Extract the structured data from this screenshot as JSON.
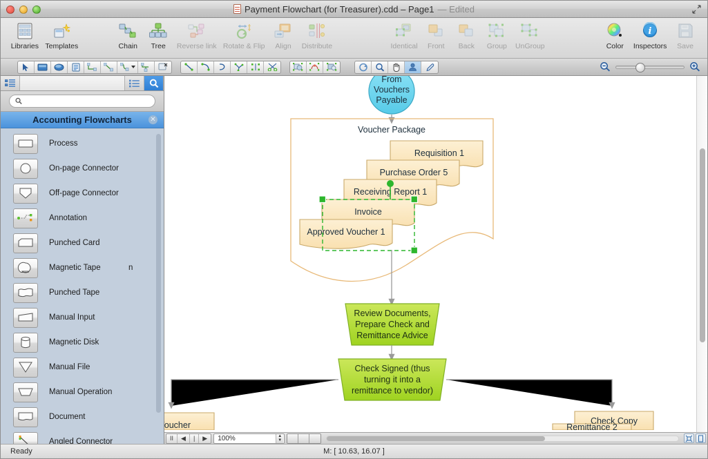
{
  "window": {
    "title": "Payment Flowchart (for Treasurer).cdd – Page1",
    "title_state": "— Edited",
    "doc_icon": "document-icon",
    "buttons": {
      "close": "close-window",
      "minimize": "minimize-window",
      "zoom": "zoom-window"
    },
    "fullscreen_icon": "fullscreen-icon"
  },
  "toolbar_main": {
    "items": [
      {
        "label": "Libraries",
        "icon": "libraries-icon",
        "enabled": true
      },
      {
        "label": "Templates",
        "icon": "templates-icon",
        "enabled": true
      },
      {
        "label": "Chain",
        "icon": "chain-icon",
        "enabled": true
      },
      {
        "label": "Tree",
        "icon": "tree-icon",
        "enabled": true
      },
      {
        "label": "Reverse link",
        "icon": "reverse-link-icon",
        "enabled": false
      },
      {
        "label": "Rotate & Flip",
        "icon": "rotate-flip-icon",
        "enabled": false
      },
      {
        "label": "Align",
        "icon": "align-icon",
        "enabled": false
      },
      {
        "label": "Distribute",
        "icon": "distribute-icon",
        "enabled": false
      },
      {
        "label": "Identical",
        "icon": "identical-icon",
        "enabled": false
      },
      {
        "label": "Front",
        "icon": "bring-front-icon",
        "enabled": false
      },
      {
        "label": "Back",
        "icon": "send-back-icon",
        "enabled": false
      },
      {
        "label": "Group",
        "icon": "group-icon",
        "enabled": false
      },
      {
        "label": "UnGroup",
        "icon": "ungroup-icon",
        "enabled": false
      },
      {
        "label": "Color",
        "icon": "color-wheel-icon",
        "enabled": true
      },
      {
        "label": "Inspectors",
        "icon": "inspectors-icon",
        "enabled": true
      },
      {
        "label": "Save",
        "icon": "save-floppy-icon",
        "enabled": false
      }
    ]
  },
  "toolbar_tools": {
    "group1": [
      "pointer-icon",
      "rectangle-icon",
      "ellipse-icon",
      "text-icon",
      "smart-connector-icon",
      "direct-connector-icon",
      "curved-connector-icon",
      "tree-connector-icon",
      "delete-connector-icon"
    ],
    "group2": [
      "line-icon",
      "arc-icon",
      "bezier-icon",
      "polyline-icon",
      "mirror-icon",
      "scissors-icon"
    ],
    "group3": [
      "union-icon",
      "intersect-icon",
      "subtract-icon"
    ],
    "group4": [
      "rotate-tool-icon",
      "magnifier-tool-icon",
      "hand-tool-icon",
      "stamp-tool-icon",
      "eyedropper-tool-icon"
    ],
    "active_tool": "stamp-tool-icon",
    "zoom_out_icon": "zoom-out-icon",
    "zoom_in_icon": "zoom-in-icon"
  },
  "sidebar": {
    "header": {
      "tree_icon": "library-tree-icon",
      "list_icon": "library-list-icon",
      "search_icon": "search-icon"
    },
    "search": {
      "value": "",
      "placeholder": "",
      "icon": "search-icon"
    },
    "category": {
      "title": "Accounting Flowcharts",
      "close_icon": "close-icon"
    },
    "items": [
      {
        "label": "Process",
        "icon": "shape-process-icon"
      },
      {
        "label": "On-page Connector",
        "icon": "shape-onpage-connector-icon"
      },
      {
        "label": "Off-page Connector",
        "icon": "shape-offpage-connector-icon"
      },
      {
        "label": "Annotation",
        "icon": "shape-annotation-icon"
      },
      {
        "label": "Punched Card",
        "icon": "shape-punched-card-icon"
      },
      {
        "label": "Magnetic Tape",
        "icon": "shape-magnetic-tape-icon"
      },
      {
        "label": "Punched Tape",
        "icon": "shape-punched-tape-icon"
      },
      {
        "label": "Manual Input",
        "icon": "shape-manual-input-icon"
      },
      {
        "label": "Magnetic Disk",
        "icon": "shape-magnetic-disk-icon"
      },
      {
        "label": "Manual File",
        "icon": "shape-manual-file-icon"
      },
      {
        "label": "Manual Operation",
        "icon": "shape-manual-operation-icon"
      },
      {
        "label": "Document",
        "icon": "shape-document-icon"
      },
      {
        "label": "Angled Connector",
        "icon": "shape-angled-connector-icon"
      }
    ],
    "stray_text": "n"
  },
  "canvas": {
    "nodes": {
      "source": "From Vouchers Payable",
      "package_title": "Voucher Package",
      "docs": [
        "Requisition 1",
        "Purchase Order 5",
        "Receiving Report 1",
        "Invoice",
        "Approved Voucher 1"
      ],
      "op1": "Review Documents, Prepare Check and Remittance Advice",
      "op1_lines": [
        "Review Documents,",
        "Prepare Check and",
        "Remittance Advice"
      ],
      "op2": "Check Signed (thus turning it into a remittance to vendor)",
      "op2_lines": [
        "Check Signed (thus",
        "turning it into a",
        "remittance to vendor)"
      ],
      "bottom_left": "d Voucher",
      "bottom_right_top": "Check Copy",
      "bottom_right_bottom": "Remittance 2"
    },
    "colors": {
      "doc_fill": "#fbe7bf",
      "doc_stroke": "#c9a96a",
      "ellipse_fill": "#6fd6ef",
      "ellipse_stroke": "#3aa7c4",
      "op_fill": "#aedd3c",
      "op_stroke": "#7fb024",
      "selection": "#2db62d",
      "connector": "#8a8a8a",
      "package_stroke": "#e8b978"
    }
  },
  "bottom_bar": {
    "pause_label": "II",
    "prev_label": "◀",
    "next_label": "▶",
    "zoom_value": "100%",
    "view_modes": [
      "view-mode-1",
      "view-mode-2",
      "view-mode-3"
    ],
    "corner_icons": [
      "fit-page-icon",
      "page-setup-icon"
    ]
  },
  "statusbar": {
    "ready": "Ready",
    "coords": "M: [ 10.63, 16.07 ]"
  }
}
